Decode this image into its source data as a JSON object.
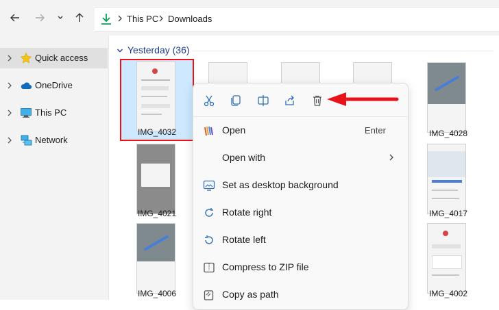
{
  "address": {
    "back_label": "Back",
    "forward_label": "Forward",
    "recent_label": "Recent locations",
    "up_label": "Up",
    "crumbs": [
      "This PC",
      "Downloads"
    ]
  },
  "sidebar": {
    "items": [
      {
        "label": "Quick access"
      },
      {
        "label": "OneDrive"
      },
      {
        "label": "This PC"
      },
      {
        "label": "Network"
      }
    ]
  },
  "content": {
    "group_label": "Yesterday (36)",
    "files": [
      {
        "name": "IMG_4032"
      },
      {
        "name": "IMG_4028"
      },
      {
        "name": "IMG_4021"
      },
      {
        "name": "IMG_4017"
      },
      {
        "name": "IMG_4006"
      },
      {
        "name": "IMG_4002"
      }
    ]
  },
  "context_menu": {
    "quick_actions": [
      "Cut",
      "Copy",
      "Rename",
      "Share",
      "Delete"
    ],
    "items": [
      {
        "label": "Open",
        "shortcut": "Enter"
      },
      {
        "label": "Open with"
      },
      {
        "label": "Set as desktop background"
      },
      {
        "label": "Rotate right"
      },
      {
        "label": "Rotate left"
      },
      {
        "label": "Compress to ZIP file"
      },
      {
        "label": "Copy as path"
      }
    ]
  },
  "colors": {
    "annotation_red": "#e8121b",
    "selection": "#cde8ff",
    "accent_blue": "#1e3a8a",
    "download_green": "#0f9d58"
  }
}
